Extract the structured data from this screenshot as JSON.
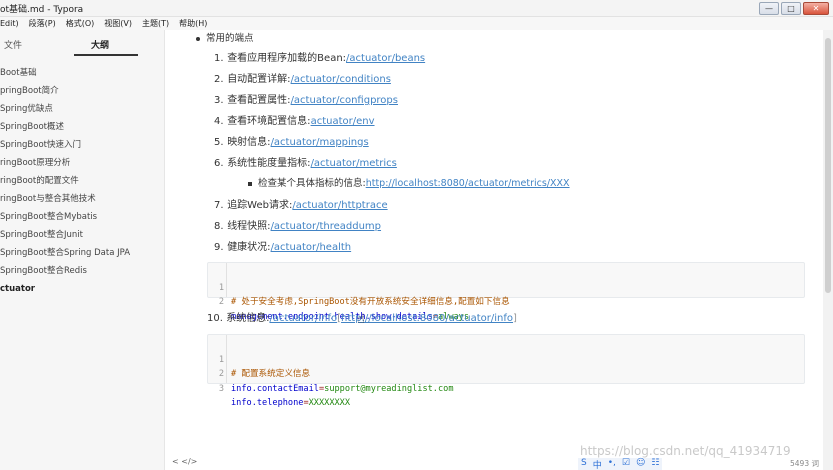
{
  "window": {
    "title": "ot基础.md - Typora",
    "buttons": {
      "minimize": "—",
      "maximize": "□",
      "close": "✕"
    }
  },
  "menubar": {
    "items": [
      "Edit)",
      "段落(P)",
      "格式(O)",
      "视图(V)",
      "主题(T)",
      "帮助(H)"
    ]
  },
  "sidebar": {
    "tabs": {
      "files": "文件",
      "outline": "大纲"
    },
    "outline": [
      {
        "label": "Boot基础",
        "active": false
      },
      {
        "label": "pringBoot简介",
        "active": false
      },
      {
        "label": "Spring优缺点",
        "active": false
      },
      {
        "label": "SpringBoot概述",
        "active": false
      },
      {
        "label": "SpringBoot快速入门",
        "active": false
      },
      {
        "label": "ringBoot原理分析",
        "active": false
      },
      {
        "label": "ringBoot的配置文件",
        "active": false
      },
      {
        "label": "ringBoot与整合其他技术",
        "active": false
      },
      {
        "label": "SpringBoot整合Mybatis",
        "active": false
      },
      {
        "label": "SpringBoot整合Junit",
        "active": false
      },
      {
        "label": "SpringBoot整合Spring Data JPA",
        "active": false
      },
      {
        "label": "SpringBoot整合Redis",
        "active": false
      },
      {
        "label": "ctuator",
        "active": true
      }
    ]
  },
  "content": {
    "bullet": "常用的端点",
    "endpoints": [
      {
        "num": "1.",
        "text": "查看应用程序加载的Bean:",
        "link": "/actuator/beans"
      },
      {
        "num": "2.",
        "text": "自动配置详解:",
        "link": "/actuator/conditions"
      },
      {
        "num": "3.",
        "text": "查看配置属性:",
        "link": "/actuator/configprops"
      },
      {
        "num": "4.",
        "text": "查看环境配置信息:",
        "link": "actuator/env"
      },
      {
        "num": "5.",
        "text": "映射信息:",
        "link": "/actuator/mappings"
      },
      {
        "num": "6.",
        "text": "系统性能度量指标:",
        "link": "/actuator/metrics"
      },
      {
        "num": "7.",
        "text": "追踪Web请求:",
        "link": "/actuator/httptrace"
      },
      {
        "num": "8.",
        "text": "线程快照:",
        "link": "/actuator/threaddump"
      },
      {
        "num": "9.",
        "text": "健康状况:",
        "link": "/actuator/health"
      }
    ],
    "sub_item": {
      "text": "检查某个具体指标的信息:",
      "link": "http://localhost:8080/actuator/metrics/XXX"
    },
    "code1": {
      "line_numbers": [
        "1",
        "2"
      ],
      "comment": "# 处于安全考虑,SpringBoot没有开放系统安全详细信息,配置如下信息",
      "key": "management.endpoint.health.show-details",
      "eq": "=",
      "value": "always"
    },
    "item10": {
      "num": "10.",
      "text": "系统信息:",
      "link1": "/actuator/info",
      "sep": "[",
      "link2": "http://localhost:8080/actuator/info",
      "end": "]"
    },
    "code2": {
      "line_numbers": [
        "1",
        "2",
        "3"
      ],
      "comment": "# 配置系统定义信息",
      "key1": "info.contactEmail",
      "eq": "=",
      "value1": "support@myreadinglist.com",
      "key2": "info.telephone",
      "value2": "XXXXXXXX"
    }
  },
  "statusbar": {
    "left": "<  </>",
    "right": "5493 词"
  },
  "watermark": "https://blog.csdn.net/qq_41934719",
  "ime": [
    "S",
    "中",
    "•,",
    "☑",
    "☺",
    "☷"
  ]
}
